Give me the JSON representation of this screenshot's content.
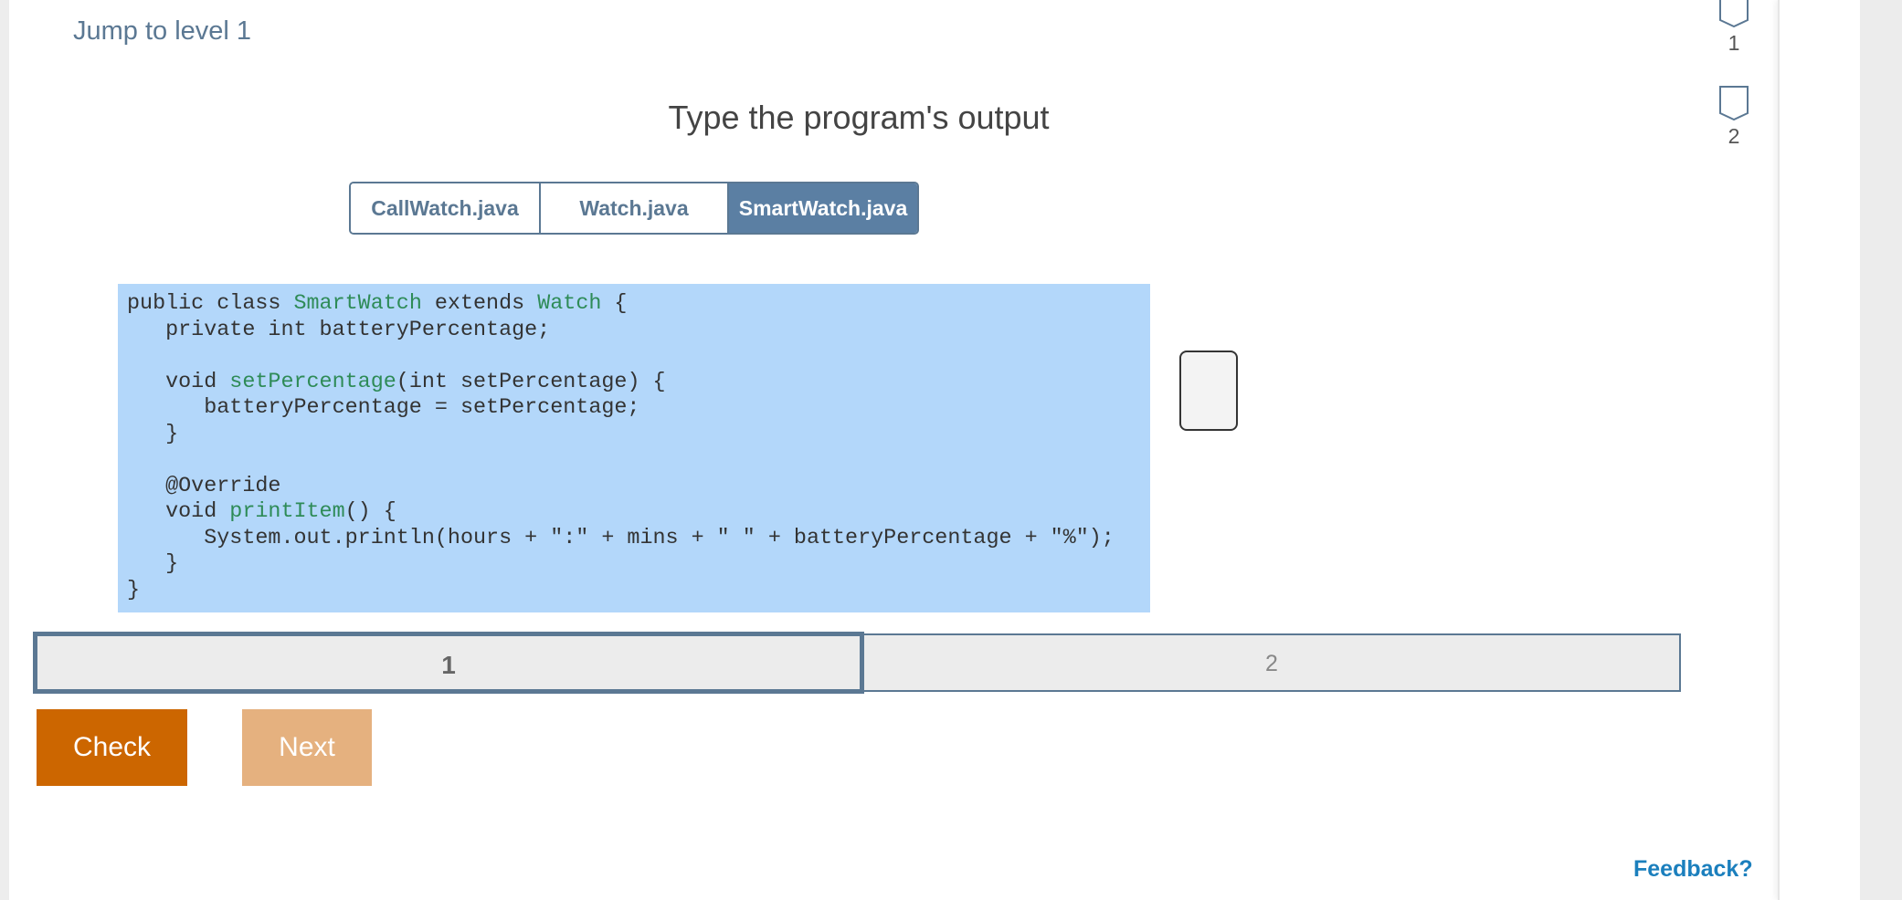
{
  "header": {
    "jump_link": "Jump to level 1",
    "title": "Type the program's output"
  },
  "levels": [
    {
      "label": "1"
    },
    {
      "label": "2"
    }
  ],
  "tabs": [
    {
      "label": "CallWatch.java",
      "active": false
    },
    {
      "label": "Watch.java",
      "active": false
    },
    {
      "label": "SmartWatch.java",
      "active": true
    }
  ],
  "code": {
    "lines": [
      "public class SmartWatch extends Watch {",
      "   private int batteryPercentage;",
      "",
      "   void setPercentage(int setPercentage) {",
      "      batteryPercentage = setPercentage;",
      "   }",
      "",
      "   @Override",
      "   void printItem() {",
      "      System.out.println(hours + \":\" + mins + \" \" + batteryPercentage + \"%\");",
      "   }",
      "}"
    ]
  },
  "output": {
    "value": ""
  },
  "progress": {
    "segments": [
      "1",
      "2"
    ],
    "current": 1
  },
  "buttons": {
    "check": "Check",
    "next": "Next"
  },
  "footer": {
    "feedback": "Feedback?"
  },
  "colors": {
    "accent": "#5b7893",
    "active_tab": "#5b7fa3",
    "code_bg": "#b3d7fa",
    "class_name": "#2e8b57",
    "check_button": "#cc6600",
    "next_button": "#e5b17f",
    "feedback_link": "#1b7fbd"
  }
}
